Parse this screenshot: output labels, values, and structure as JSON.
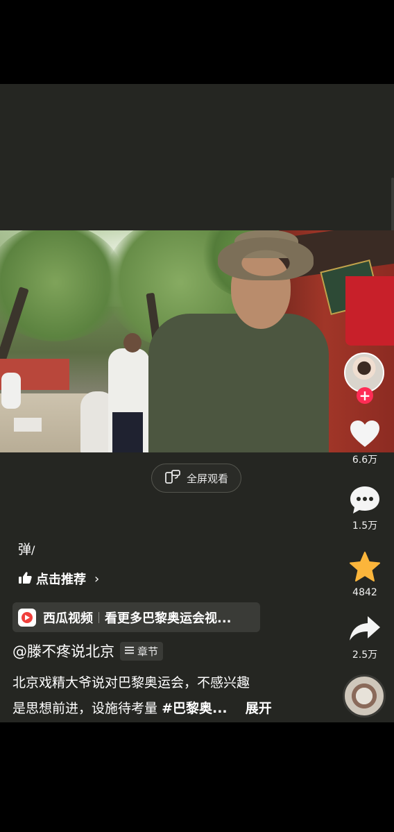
{
  "fullscreen_button": {
    "label": "全屏观看",
    "icon": "rotate-screen-icon"
  },
  "actions": {
    "like": {
      "icon": "heart-icon",
      "count": "6.6万"
    },
    "comment": {
      "icon": "comment-bubble-icon",
      "count": "1.5万"
    },
    "favorite": {
      "icon": "star-icon",
      "count": "4842",
      "color": "#FBB53B"
    },
    "share": {
      "icon": "share-arrow-icon",
      "count": "2.5万"
    }
  },
  "follow": {
    "plus": "+",
    "color": "#FE2C55"
  },
  "danmu": {
    "label": "弹"
  },
  "recommend": {
    "label": "点击推荐",
    "icon": "thumbs-up-icon"
  },
  "xigua": {
    "app_name": "西瓜视频",
    "more_text": "看更多巴黎奥运会视..."
  },
  "author": {
    "handle": "@滕不疼说北京",
    "chapter_label": "章节"
  },
  "description": {
    "line1": "北京戏精大爷说对巴黎奥运会，不感兴趣",
    "line2": "是思想前进，设施待考量",
    "hashtag": "#巴黎奥...",
    "expand": "展开"
  }
}
